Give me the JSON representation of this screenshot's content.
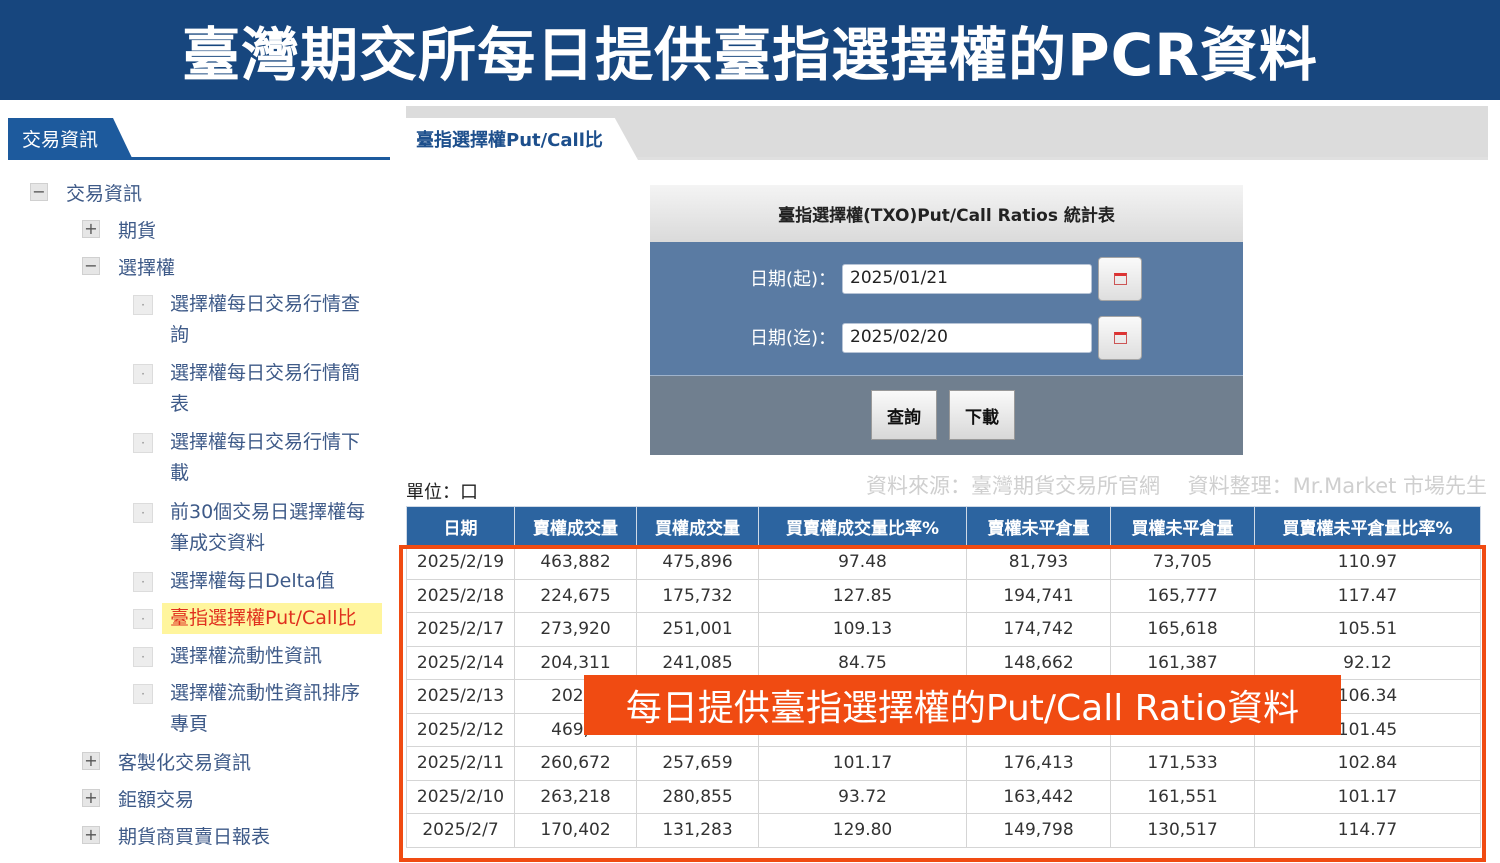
{
  "banner": {
    "title": "臺灣期交所每日提供臺指選擇權的PCR資料"
  },
  "sidebar": {
    "tab_label": "交易資訊",
    "tree": [
      {
        "toggle": "−",
        "label": "交易資訊"
      },
      {
        "toggle": "+",
        "label": "期貨"
      },
      {
        "toggle": "−",
        "label": "選擇權"
      },
      {
        "bullet": "·",
        "label": "選擇權每日交易行情查詢"
      },
      {
        "bullet": "·",
        "label": "選擇權每日交易行情簡表"
      },
      {
        "bullet": "·",
        "label": "選擇權每日交易行情下載"
      },
      {
        "bullet": "·",
        "label": "前30個交易日選擇權每筆成交資料"
      },
      {
        "bullet": "·",
        "label": "選擇權每日Delta值"
      },
      {
        "bullet": "·",
        "label": "臺指選擇權Put/Call比"
      },
      {
        "bullet": "·",
        "label": "選擇權流動性資訊"
      },
      {
        "bullet": "·",
        "label": "選擇權流動性資訊排序專頁"
      },
      {
        "toggle": "+",
        "label": "客製化交易資訊"
      },
      {
        "toggle": "+",
        "label": "鉅額交易"
      },
      {
        "toggle": "+",
        "label": "期貨商買賣日報表"
      }
    ]
  },
  "main": {
    "tab_label": "臺指選擇權Put/Call比",
    "query": {
      "title": "臺指選擇權(TXO)Put/Call Ratios 統計表",
      "start_label": "日期(起)：",
      "start_value": "2025/01/21",
      "end_label": "日期(迄)：",
      "end_value": "2025/02/20",
      "query_button": "查詢",
      "download_button": "下載"
    },
    "unit_label": "單位：口",
    "source_note": "資料來源：臺灣期貨交易所官網　  資料整理：Mr.Market 市場先生",
    "table": {
      "headers": [
        "日期",
        "賣權成交量",
        "買權成交量",
        "買賣權成交量比率%",
        "賣權未平倉量",
        "買權未平倉量",
        "買賣權未平倉量比率%"
      ],
      "rows": [
        [
          "2025/2/19",
          "463,882",
          "475,896",
          "97.48",
          "81,793",
          "73,705",
          "110.97"
        ],
        [
          "2025/2/18",
          "224,675",
          "175,732",
          "127.85",
          "194,741",
          "165,777",
          "117.47"
        ],
        [
          "2025/2/17",
          "273,920",
          "251,001",
          "109.13",
          "174,742",
          "165,618",
          "105.51"
        ],
        [
          "2025/2/14",
          "204,311",
          "241,085",
          "84.75",
          "148,662",
          "161,387",
          "92.12"
        ],
        [
          "2025/2/13",
          "202,5",
          "",
          "",
          "",
          "",
          "106.34"
        ],
        [
          "2025/2/12",
          "469,3",
          "",
          "",
          "",
          "",
          "101.45"
        ],
        [
          "2025/2/11",
          "260,672",
          "257,659",
          "101.17",
          "176,413",
          "171,533",
          "102.84"
        ],
        [
          "2025/2/10",
          "263,218",
          "280,855",
          "93.72",
          "163,442",
          "161,551",
          "101.17"
        ],
        [
          "2025/2/7",
          "170,402",
          "131,283",
          "129.80",
          "149,798",
          "130,517",
          "114.77"
        ]
      ]
    },
    "overlay_caption": "每日提供臺指選擇權的Put/Call Ratio資料"
  },
  "colors": {
    "banner": "#17467e",
    "accent": "#1d5a9d",
    "table_header": "#2c64a0",
    "highlight": "#f04b12"
  }
}
